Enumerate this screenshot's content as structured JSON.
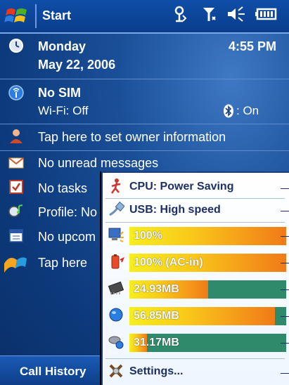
{
  "titlebar": {
    "title": "Start"
  },
  "today": {
    "date_day": "Monday",
    "date_full": "May 22, 2006",
    "time": "4:55 PM",
    "wireless_status": "No SIM",
    "wifi": "Wi-Fi: Off",
    "bluetooth": ": On",
    "owner": "Tap here to set owner information",
    "messages": "No unread messages",
    "tasks": "No tasks",
    "profile": "Profile: No",
    "calendar": "No upcom",
    "getstarted": "Tap here"
  },
  "softkeys": {
    "left": "Call History"
  },
  "popup": {
    "cpu": "CPU: Power Saving",
    "usb": "USB: High speed",
    "bars": [
      {
        "name": "backlight",
        "icon": "brightness-icon",
        "text": "100%",
        "level": 1.0
      },
      {
        "name": "battery",
        "icon": "battery-icon",
        "text": "100% (AC-in)",
        "level": 1.0
      },
      {
        "name": "memory",
        "icon": "memory-chip-icon",
        "text": "24.93MB",
        "level": 0.5
      },
      {
        "name": "storage",
        "icon": "storage-icon",
        "text": "56.85MB",
        "level": 0.93
      },
      {
        "name": "storage-card",
        "icon": "storage-card-icon",
        "text": "31.17MB",
        "level": 0.11
      }
    ],
    "settings": "Settings..."
  }
}
